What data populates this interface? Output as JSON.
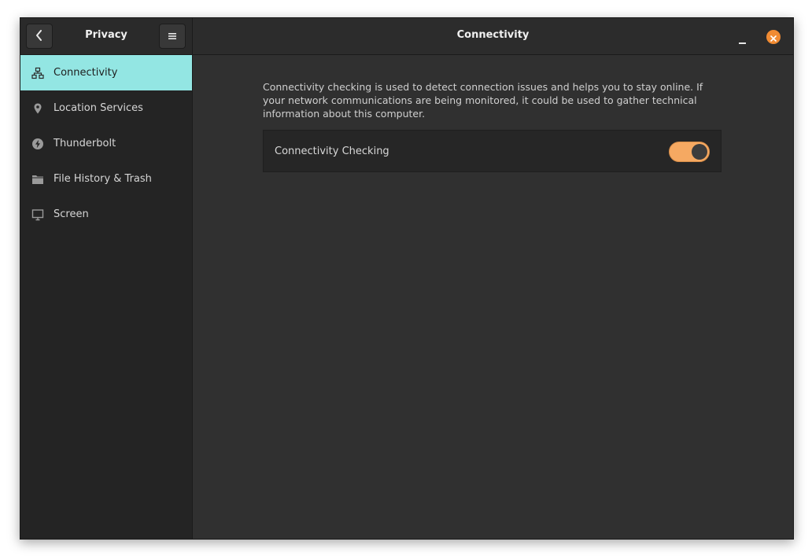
{
  "sidebar": {
    "title": "Privacy",
    "items": [
      {
        "label": "Connectivity",
        "icon": "network-icon",
        "active": true
      },
      {
        "label": "Location Services",
        "icon": "location-pin-icon",
        "active": false
      },
      {
        "label": "Thunderbolt",
        "icon": "thunderbolt-icon",
        "active": false
      },
      {
        "label": "File History & Trash",
        "icon": "folder-icon",
        "active": false
      },
      {
        "label": "Screen",
        "icon": "monitor-icon",
        "active": false
      }
    ]
  },
  "header": {
    "title": "Connectivity"
  },
  "main": {
    "description": "Connectivity checking is used to detect connection issues and helps you to stay online. If your network communications are being monitored, it could be used to gather technical information about this computer.",
    "setting": {
      "label": "Connectivity Checking",
      "enabled": true
    }
  },
  "colors": {
    "accent_selection": "#93e6e3",
    "toggle_on": "#f5a962",
    "close_button": "#f08b33"
  }
}
